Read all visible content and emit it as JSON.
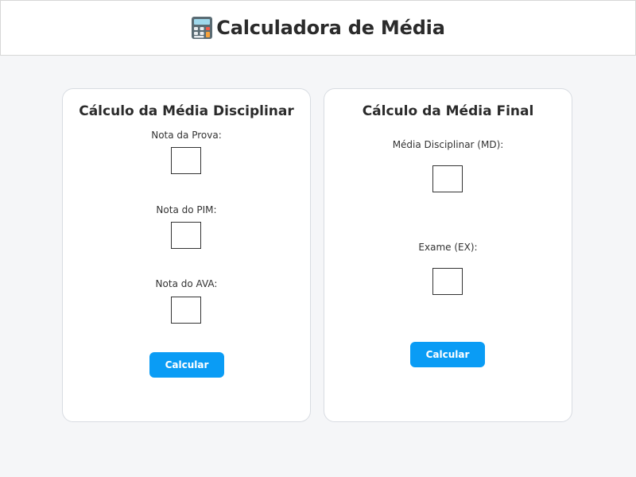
{
  "header": {
    "title": "Calculadora de Média",
    "icon": "calculator-icon"
  },
  "card_left": {
    "title": "Cálculo da Média Disciplinar",
    "fields": [
      {
        "label": "Nota da Prova:",
        "value": ""
      },
      {
        "label": "Nota do PIM:",
        "value": ""
      },
      {
        "label": "Nota do AVA:",
        "value": ""
      }
    ],
    "button_label": "Calcular"
  },
  "card_right": {
    "title": "Cálculo da Média Final",
    "fields": [
      {
        "label": "Média Disciplinar (MD):",
        "value": ""
      },
      {
        "label": "Exame (EX):",
        "value": ""
      }
    ],
    "button_label": "Calcular"
  },
  "colors": {
    "accent": "#0a9cf5",
    "background": "#f5f6f8",
    "card": "#ffffff"
  }
}
